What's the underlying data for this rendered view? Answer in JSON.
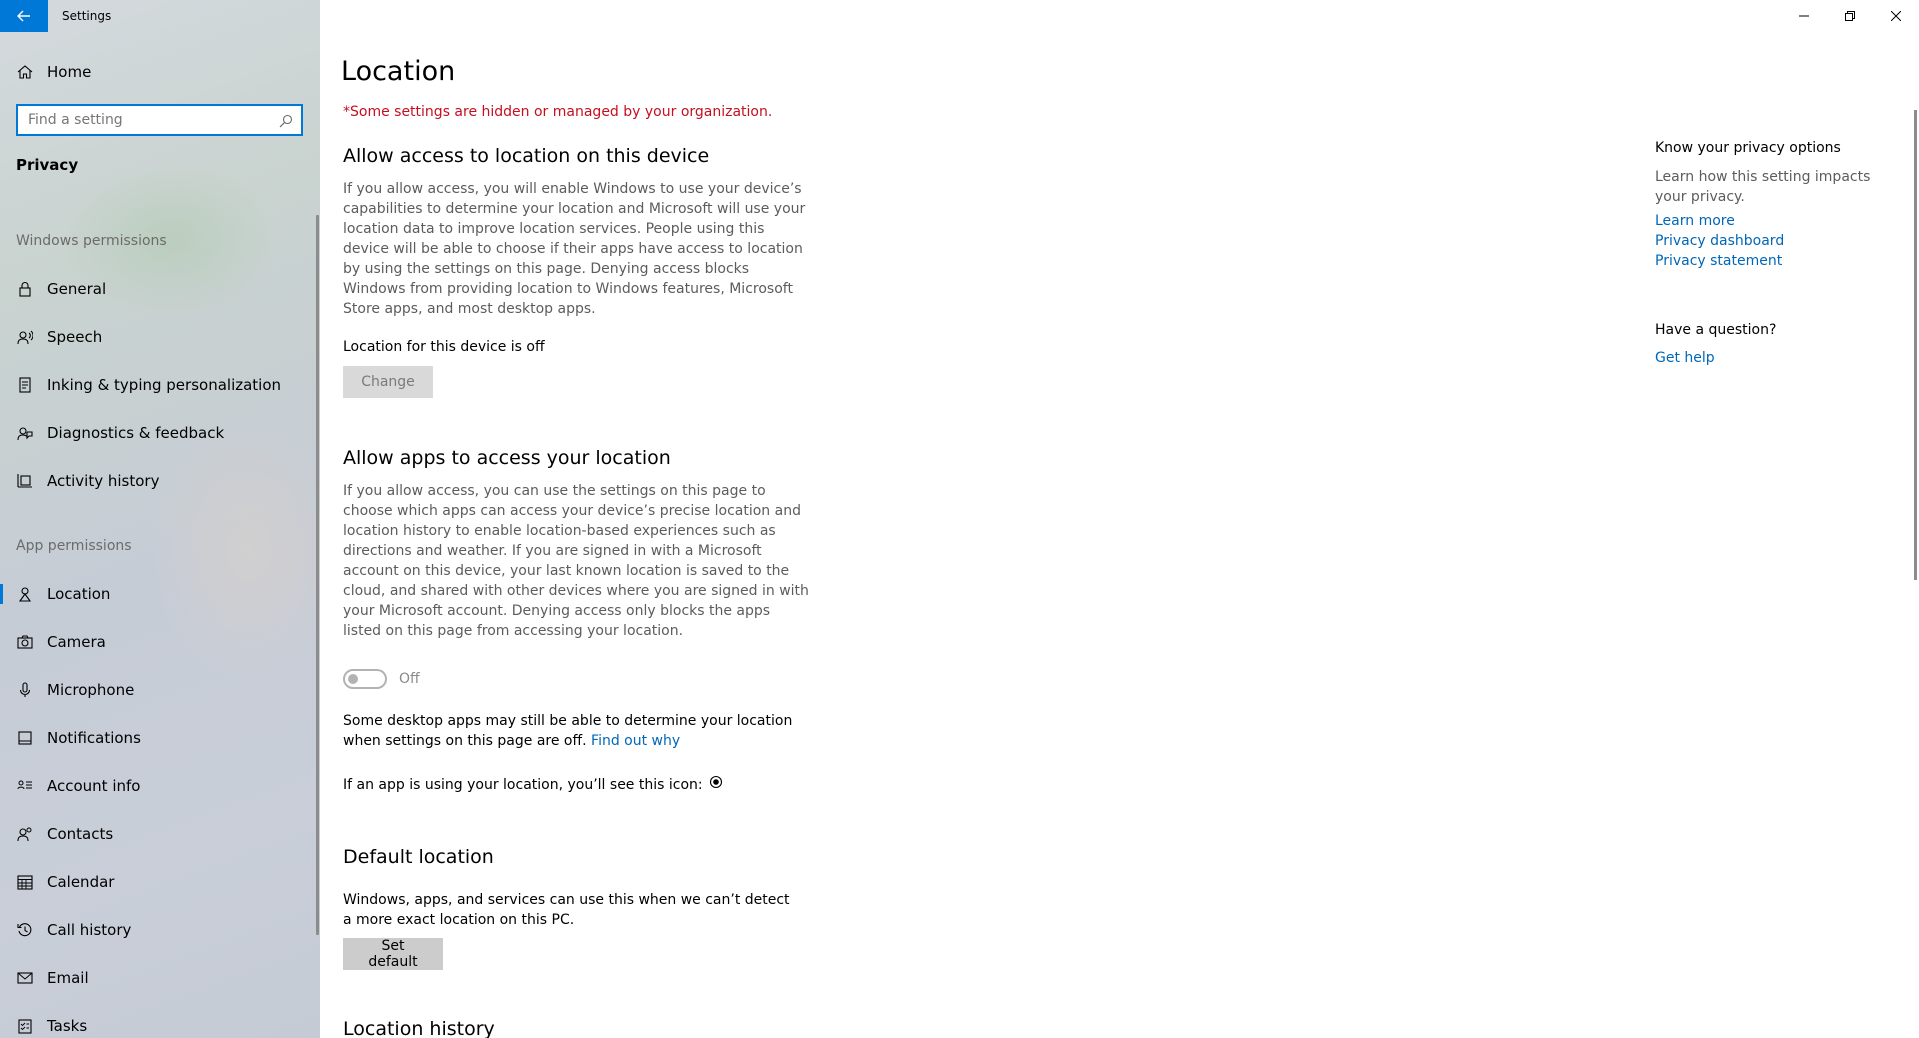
{
  "window": {
    "title": "Settings",
    "controls": {
      "minimize": "minimize-icon",
      "restore": "restore-icon",
      "close": "close-icon"
    }
  },
  "sidebar": {
    "home_label": "Home",
    "search_placeholder": "Find a setting",
    "section_title": "Privacy",
    "group_windows": "Windows permissions",
    "group_app": "App permissions",
    "windows_items": [
      {
        "label": "General",
        "icon": "lock-icon"
      },
      {
        "label": "Speech",
        "icon": "speech-icon"
      },
      {
        "label": "Inking & typing personalization",
        "icon": "inking-icon"
      },
      {
        "label": "Diagnostics & feedback",
        "icon": "diagnostics-icon"
      },
      {
        "label": "Activity history",
        "icon": "activity-history-icon"
      }
    ],
    "app_items": [
      {
        "label": "Location",
        "icon": "location-icon",
        "active": true
      },
      {
        "label": "Camera",
        "icon": "camera-icon"
      },
      {
        "label": "Microphone",
        "icon": "microphone-icon"
      },
      {
        "label": "Notifications",
        "icon": "notifications-icon"
      },
      {
        "label": "Account info",
        "icon": "account-info-icon"
      },
      {
        "label": "Contacts",
        "icon": "contacts-icon"
      },
      {
        "label": "Calendar",
        "icon": "calendar-icon"
      },
      {
        "label": "Call history",
        "icon": "call-history-icon"
      },
      {
        "label": "Email",
        "icon": "email-icon"
      },
      {
        "label": "Tasks",
        "icon": "tasks-icon"
      }
    ]
  },
  "main": {
    "title": "Location",
    "managed_notice": "*Some settings are hidden or managed by your organization.",
    "device_access": {
      "heading": "Allow access to location on this device",
      "description": "If you allow access, you will enable Windows to use your device’s capabilities to determine your location and Microsoft will use your location data to improve location services. People using this device will be able to choose if their apps have access to location by using the settings on this page. Denying access blocks Windows from providing location to Windows features, Microsoft Store apps, and most desktop apps.",
      "status": "Location for this device is off",
      "change_button": "Change"
    },
    "apps_access": {
      "heading": "Allow apps to access your location",
      "description": "If you allow access, you can use the settings on this page to choose which apps can access your device’s precise location and location history to enable location-based experiences such as directions and weather. If you are signed in with a Microsoft account on this device, your last known location is saved to the cloud, and shared with other devices where you are signed in with your Microsoft account. Denying access only blocks the apps listed on this page from accessing your location.",
      "toggle_state": "Off",
      "toggle_on": false,
      "desktop_note": "Some desktop apps may still be able to determine your location when settings on this page are off.",
      "find_out_why": "Find out why",
      "icon_note": "If an app is using your location, you’ll see this icon:"
    },
    "default_location": {
      "heading": "Default location",
      "description": "Windows, apps, and services can use this when we can’t detect a more exact location on this PC.",
      "set_default_button": "Set default"
    },
    "location_history": {
      "heading": "Location history"
    }
  },
  "right_panel": {
    "privacy_heading": "Know your privacy options",
    "privacy_text": "Learn how this setting impacts your privacy.",
    "links": [
      "Learn more",
      "Privacy dashboard",
      "Privacy statement"
    ],
    "question_heading": "Have a question?",
    "get_help": "Get help"
  },
  "colors": {
    "accent": "#0078d7",
    "link": "#0067b8",
    "warning": "#c50f1f"
  }
}
